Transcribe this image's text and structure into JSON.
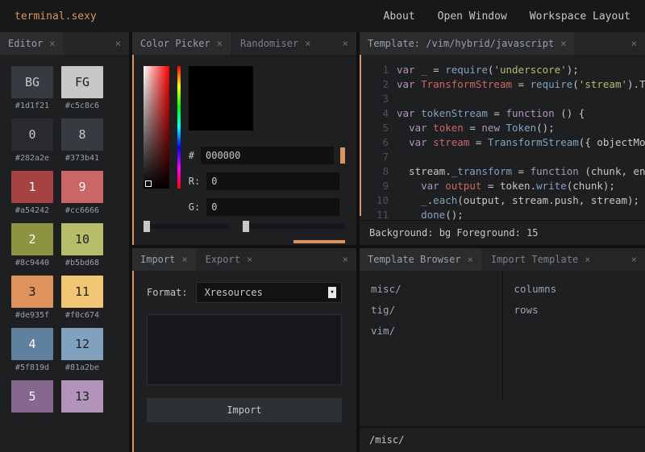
{
  "brand": "terminal.sexy",
  "nav": {
    "about": "About",
    "openWindow": "Open Window",
    "workspaceLayout": "Workspace Layout"
  },
  "editor": {
    "tab": "Editor",
    "swatches": [
      {
        "label": "BG",
        "hex": "#1d1f21",
        "bg": "#373b41",
        "fg": "#c5c8c6"
      },
      {
        "label": "FG",
        "hex": "#c5c8c6",
        "bg": "#c5c8c6",
        "fg": "#1d1f21"
      },
      {
        "label": "0",
        "hex": "#282a2e",
        "bg": "#282a2e",
        "fg": "#c5c8c6"
      },
      {
        "label": "8",
        "hex": "#373b41",
        "bg": "#373b41",
        "fg": "#c5c8c6"
      },
      {
        "label": "1",
        "hex": "#a54242",
        "bg": "#a54242",
        "fg": "#ffffff"
      },
      {
        "label": "9",
        "hex": "#cc6666",
        "bg": "#cc6666",
        "fg": "#ffffff"
      },
      {
        "label": "2",
        "hex": "#8c9440",
        "bg": "#8c9440",
        "fg": "#ffffff"
      },
      {
        "label": "10",
        "hex": "#b5bd68",
        "bg": "#b5bd68",
        "fg": "#1d1f21"
      },
      {
        "label": "3",
        "hex": "#de935f",
        "bg": "#de935f",
        "fg": "#1d1f21"
      },
      {
        "label": "11",
        "hex": "#f0c674",
        "bg": "#f0c674",
        "fg": "#1d1f21"
      },
      {
        "label": "4",
        "hex": "#5f819d",
        "bg": "#5f819d",
        "fg": "#ffffff"
      },
      {
        "label": "12",
        "hex": "#81a2be",
        "bg": "#81a2be",
        "fg": "#1d1f21"
      },
      {
        "label": "5",
        "hex": "",
        "bg": "#85678f",
        "fg": "#ffffff"
      },
      {
        "label": "13",
        "hex": "",
        "bg": "#b294bb",
        "fg": "#1d1f21"
      }
    ]
  },
  "colorPicker": {
    "tab1": "Color Picker",
    "tab2": "Randomiser",
    "hashLabel": "#",
    "hex": "000000",
    "rLabel": "R:",
    "gLabel": "G:",
    "r": "0",
    "g": "0"
  },
  "template": {
    "tabPath": "Template: /vim/hybrid/javascript",
    "code": [
      {
        "n": "1",
        "html": "<span class='kw'>var</span> <span class='id'>_</span> = <span class='fn'>require</span>(<span class='str'>'underscore'</span>);"
      },
      {
        "n": "2",
        "html": "<span class='kw'>var</span> <span class='id'>TransformStream</span> = <span class='fn'>require</span>(<span class='str'>'stream'</span>).Transf"
      },
      {
        "n": "3",
        "html": ""
      },
      {
        "n": "4",
        "html": "<span class='kw'>var</span> <span class='fn'>tokenStream</span> = <span class='kw'>function</span> () {"
      },
      {
        "n": "5",
        "html": "  <span class='kw'>var</span> <span class='id'>token</span> = <span class='kw'>new</span> <span class='fn'>Token</span>();"
      },
      {
        "n": "6",
        "html": "  <span class='kw'>var</span> <span class='id'>stream</span> = <span class='fn'>TransformStream</span>({ objectMode: <span class='id'>t</span>"
      },
      {
        "n": "7",
        "html": ""
      },
      {
        "n": "8",
        "html": "  stream.<span class='fn'>_transform</span> = <span class='kw'>function</span> (chunk, encodin"
      },
      {
        "n": "9",
        "html": "    <span class='kw'>var</span> <span class='id'>output</span> = token.<span class='fn'>write</span>(chunk);"
      },
      {
        "n": "10",
        "html": "    <span class='id'>_</span>.<span class='fn'>each</span>(output, stream.push, stream);"
      },
      {
        "n": "11",
        "html": "    <span class='fn'>done</span>();"
      }
    ],
    "status": "Background: bg Foreground: 15"
  },
  "import": {
    "tab1": "Import",
    "tab2": "Export",
    "formatLabel": "Format:",
    "formatValue": "Xresources",
    "button": "Import"
  },
  "browser": {
    "tab1": "Template Browser",
    "tab2": "Import Template",
    "left": [
      "misc/",
      "tig/",
      "vim/"
    ],
    "right": [
      "columns",
      "rows"
    ],
    "path": "/misc/"
  }
}
